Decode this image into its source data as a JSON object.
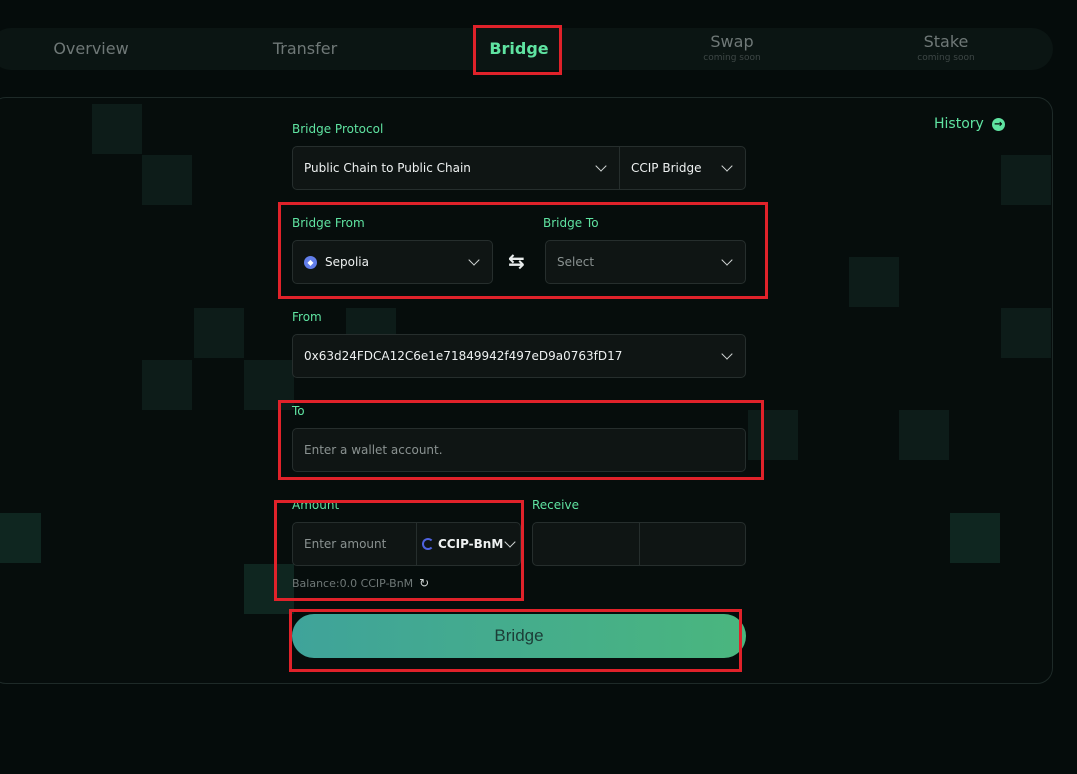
{
  "nav": {
    "tabs": [
      {
        "label": "Overview",
        "sub": ""
      },
      {
        "label": "Transfer",
        "sub": ""
      },
      {
        "label": "Bridge",
        "sub": ""
      },
      {
        "label": "Swap",
        "sub": "coming soon"
      },
      {
        "label": "Stake",
        "sub": "coming soon"
      }
    ],
    "active": "Bridge"
  },
  "history": {
    "label": "History",
    "icon": "arrow-right-circle-icon"
  },
  "form": {
    "protocol": {
      "label": "Bridge Protocol",
      "type_value": "Public Chain to Public Chain",
      "bridge_value": "CCIP Bridge"
    },
    "bridge_from": {
      "label": "Bridge From",
      "value": "Sepolia",
      "icon": "ethereum-icon"
    },
    "bridge_to": {
      "label": "Bridge To",
      "value": "Select"
    },
    "swap_icon": "swap-arrows-icon",
    "from": {
      "label": "From",
      "value": "0x63d24FDCA12C6e1e71849942f497eD9a0763fD17"
    },
    "to": {
      "label": "To",
      "placeholder": "Enter a wallet account."
    },
    "amount": {
      "label": "Amount",
      "placeholder": "Enter amount",
      "token": "CCIP-BnM"
    },
    "receive": {
      "label": "Receive",
      "value": ""
    },
    "balance": "Balance:0.0 CCIP-BnM",
    "submit": "Bridge"
  },
  "colors": {
    "accent": "#5fe3a1",
    "highlight": "#e0222a",
    "background": "#050c0b"
  }
}
